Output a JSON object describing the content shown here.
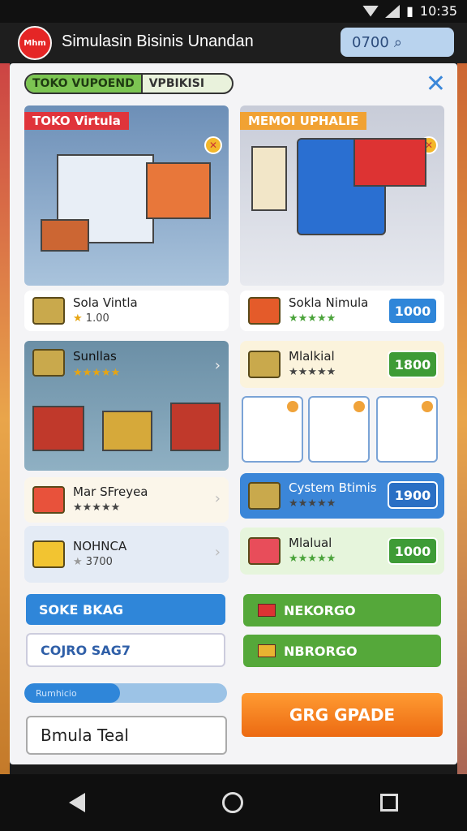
{
  "status": {
    "time": "10:35"
  },
  "app": {
    "logo_text": "Mhm",
    "title": "Simulasin Bisinis Unandan",
    "search_value": "0700",
    "search_icon": "search-icon"
  },
  "tabs": {
    "tab1": "TOKO VUPOEND",
    "tab2": "VPBIKISI"
  },
  "cards": {
    "left_top_ribbon": "TOKO Virtula",
    "right_top_ribbon": "MEMOI UPHALIE"
  },
  "rows": {
    "left_top": {
      "title": "Sola Vintla",
      "value": "1.00"
    },
    "right_top": {
      "title": "Sokla Nimula",
      "price": "1000"
    },
    "right_2": {
      "title": "Mlalkial",
      "price": "1800"
    },
    "left_mid_title": "Sunllas",
    "left_3": {
      "title": "Mar SFreyea"
    },
    "right_3": {
      "title": "Cystem Btimis",
      "price": "1900"
    },
    "left_4": {
      "title": "NOHNCA",
      "value": "3700"
    },
    "right_4": {
      "title": "Mlalual",
      "price": "1000"
    }
  },
  "buttons": {
    "soke": "SOKE BKAG",
    "cojro": "COJRO SAG7",
    "green1": "NEKORGO",
    "green2": "NBRORGO",
    "progress_text": "Rumhicio",
    "simula": "Bmula Teal",
    "upgrade": "GRG GPADE"
  },
  "colors": {
    "accent": "#2f86d9",
    "green": "#5aa83a",
    "orange": "#f07a1a"
  },
  "progress": {
    "fraction": 0.47
  }
}
